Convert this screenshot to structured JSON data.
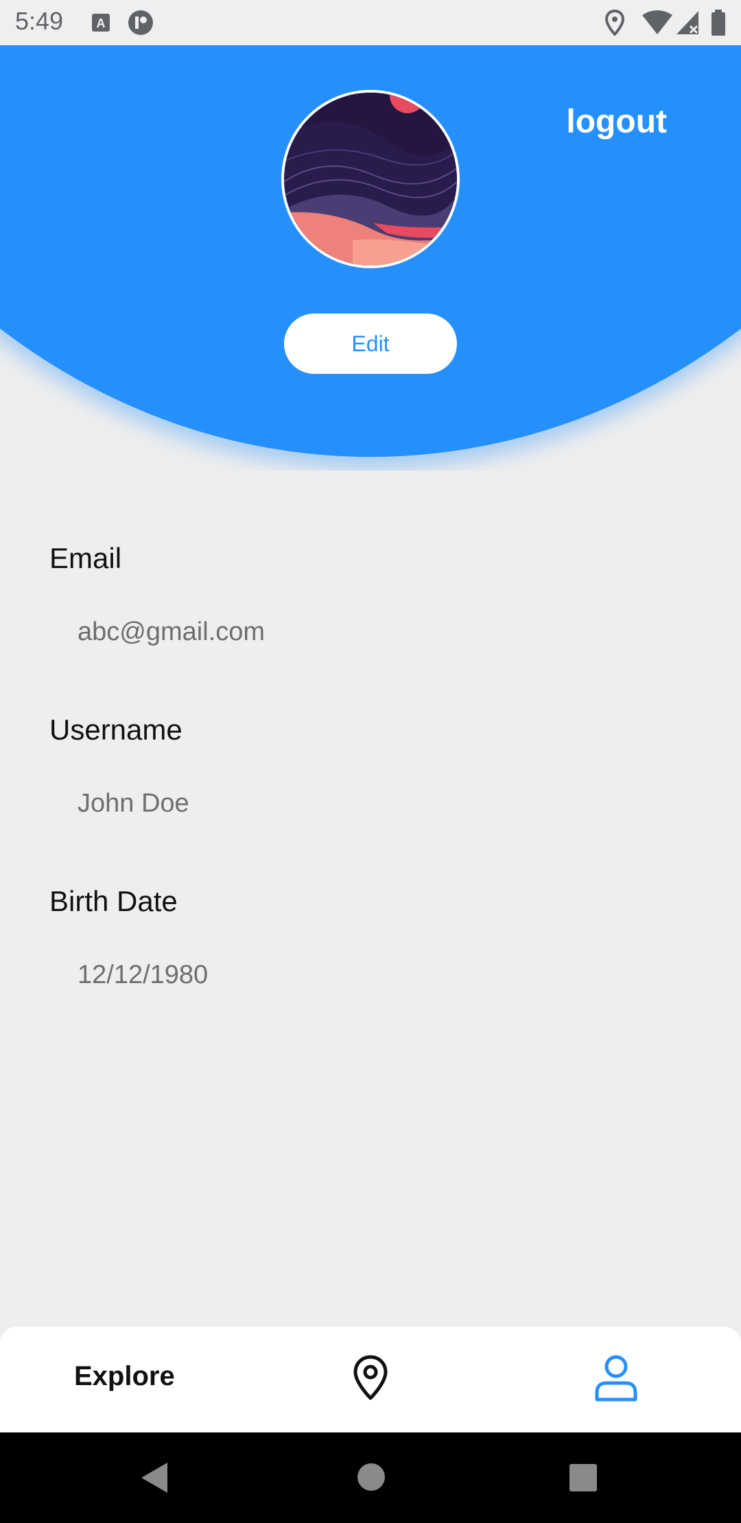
{
  "status_bar": {
    "time": "5:49",
    "left_icons": [
      "a-font-icon",
      "app-notification-icon"
    ],
    "right_icons": [
      "location-icon",
      "wifi-icon",
      "signal-icon",
      "battery-icon"
    ]
  },
  "header": {
    "logout_label": "logout",
    "edit_label": "Edit",
    "background_color": "#2590fc"
  },
  "profile": {
    "email_label": "Email",
    "email_value": "abc@gmail.com",
    "username_label": "Username",
    "username_value": "John Doe",
    "birthdate_label": "Birth Date",
    "birthdate_value": "12/12/1980"
  },
  "bottom_nav": {
    "explore_label": "Explore",
    "items": [
      "explore",
      "map-pin-icon",
      "person-icon"
    ],
    "active_color": "#2590fc"
  }
}
